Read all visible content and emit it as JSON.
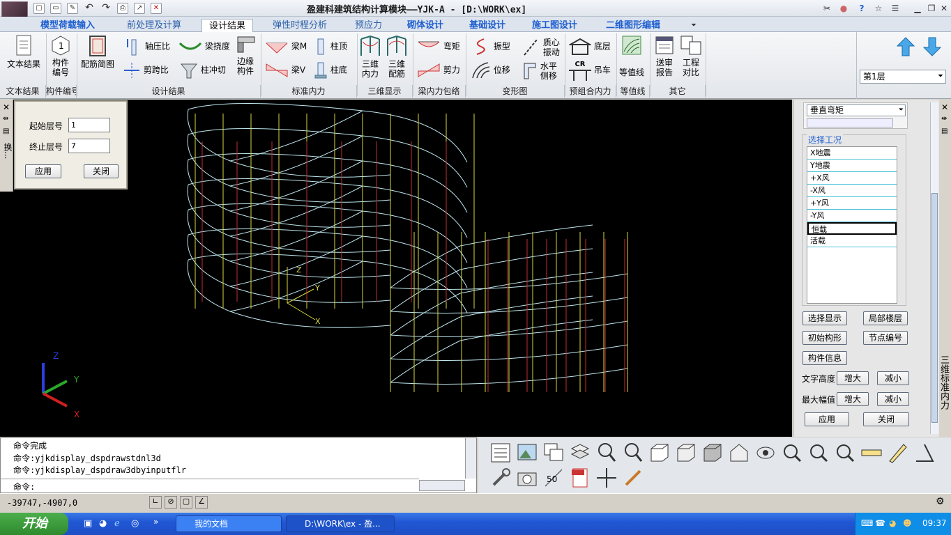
{
  "window": {
    "title": "盈建科建筑结构计算模块——YJK-A - [D:\\WORK\\ex]",
    "quick_access_icons": [
      "new-icon",
      "open-icon",
      "save-icon",
      "undo-icon",
      "redo-icon",
      "print-icon",
      "export-icon",
      "close-file-icon"
    ],
    "controls_icons": [
      "tools-icon",
      "user-icon",
      "help-icon",
      "star-icon",
      "window-list-icon",
      "minimize-icon",
      "restore-icon",
      "close-icon"
    ]
  },
  "tabs": [
    {
      "label": "模型荷载输入"
    },
    {
      "label": "前处理及计算"
    },
    {
      "label": "设计结果"
    },
    {
      "label": "弹性时程分析"
    },
    {
      "label": "预应力"
    },
    {
      "label": "砌体设计"
    },
    {
      "label": "基础设计"
    },
    {
      "label": "施工图设计"
    },
    {
      "label": "二维图形编辑"
    }
  ],
  "ribbon": {
    "buttons": {
      "text_result": "文本结果",
      "member_no": "构件编号",
      "rebar_diagram": "配筋简图",
      "axial_ratio": "轴压比",
      "beam_deflection": "梁挠度",
      "shear_span": "剪跨比",
      "column_punch": "柱冲切",
      "edge_member": "边缘构件",
      "beam_m": "梁M",
      "column_top": "柱顶",
      "beam_v": "梁V",
      "column_bottom": "柱底",
      "internal_3d": "三维内力",
      "rebar_3d": "三维配筋",
      "moment": "弯矩",
      "shear": "剪力",
      "mode_shape": "振型",
      "mass_center_vib": "质心振动",
      "displacement": "位移",
      "horizontal_drift": "水平侧移",
      "bottom_layer": "底层",
      "crane": "吊车",
      "crane_badge": "CR",
      "contour": "等值线",
      "review_report": "送审报告",
      "project_compare": "工程对比"
    },
    "groups": [
      "文本结果",
      "构件编号",
      "设计结果",
      "标准内力",
      "三维显示",
      "梁内力包络",
      "变形图",
      "预组合内力",
      "等值线",
      "其它"
    ],
    "layer_select": "第1层"
  },
  "floor_panel": {
    "start_label": "起始层号",
    "start_value": "1",
    "end_label": "终止层号",
    "end_value": "7",
    "apply": "应用",
    "close": "关闭",
    "strip_label": "换..."
  },
  "viewport": {
    "axis_labels": {
      "z": "Z",
      "y": "Y",
      "x": "X"
    }
  },
  "right_panel": {
    "combo": "垂直弯矩",
    "section_title": "选择工况",
    "load_cases": [
      "X地震",
      "Y地震",
      "+X风",
      "-X风",
      "+Y风",
      "-Y风",
      "恒载",
      "活载"
    ],
    "selected_case": "恒载",
    "buttons": {
      "select_display": "选择显示",
      "local_floor": "局部楼层",
      "initial_shape": "初始构形",
      "node_number": "节点编号",
      "member_info": "构件信息",
      "text_height": "文字高度",
      "max_amplitude": "最大幅值",
      "increase": "增大",
      "decrease": "减小",
      "apply": "应用",
      "close": "关闭"
    },
    "vertical_title": "三维标准内力"
  },
  "command": {
    "lines": [
      "命令完成",
      "命令:yjkdisplay_dspdrawstdnl3d",
      "命令:yjkdisplay_dspdraw3dbyinputflr"
    ],
    "prompt": "命令:"
  },
  "status": {
    "coords": "-39747,-4907,0"
  },
  "taskbar": {
    "start": "开始",
    "task1": "我的文档",
    "task2": "D:\\WORK\\ex - 盈...",
    "time": "09:37"
  },
  "colors": {
    "accent_tab": "#1e5fd0",
    "viewport_bg": "#000000",
    "frame_lines": "#bfe8f0",
    "column_red": "#c03030",
    "column_yellow": "#d8d840",
    "taskbar_blue": "#2157d4"
  }
}
